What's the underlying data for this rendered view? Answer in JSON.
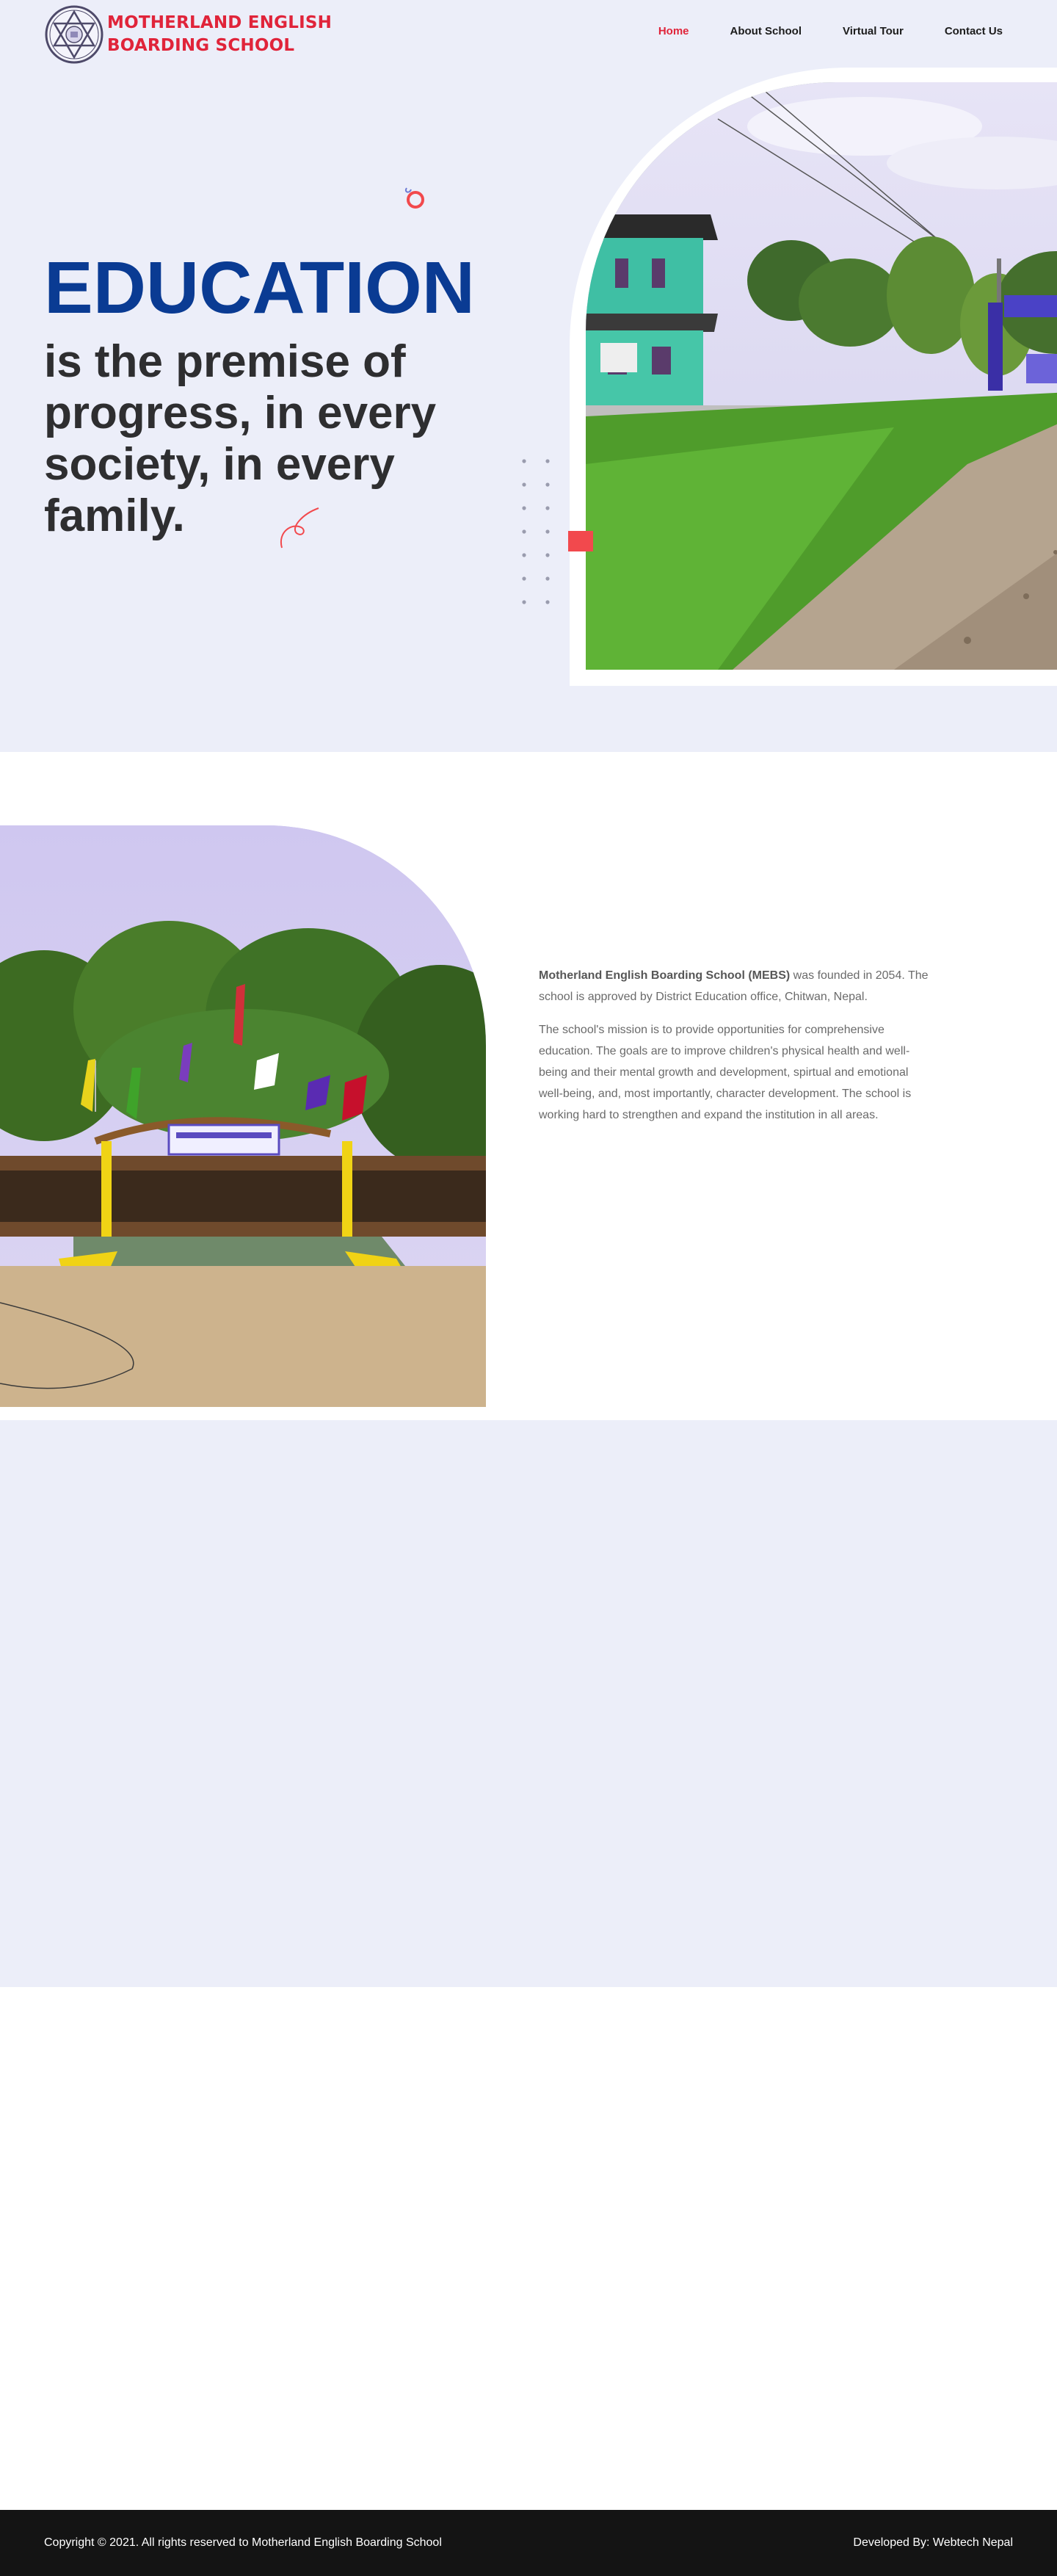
{
  "header": {
    "logo_line1": "MOTHERLAND ENGLISH",
    "logo_line2": "BOARDING SCHOOL",
    "nav": [
      {
        "label": "Home",
        "active": true
      },
      {
        "label": "About School",
        "active": false
      },
      {
        "label": "Virtual Tour",
        "active": false
      },
      {
        "label": "Contact Us",
        "active": false
      }
    ]
  },
  "hero": {
    "title": "EDUCATION",
    "subtitle": "is the premise of progress, in every society, in every family."
  },
  "about": {
    "school_name": "Motherland English Boarding School (MEBS)",
    "intro_rest": " was founded in 2054. The school is approved by District Education office, Chitwan, Nepal.",
    "mission": "The school's mission is to provide opportunities for comprehensive education. The goals are to improve children's physical health and well-being and their mental growth and development, spirtual and emotional well-being, and, most importantly, character development. The school is working hard to strengthen and expand the institution in all areas."
  },
  "footer": {
    "copyright": "Copyright © 2021. All rights reserved to Motherland English Boarding School",
    "developer": "Developed By: Webtech Nepal"
  },
  "colors": {
    "brand_red": "#e0243a",
    "brand_blue": "#0a3b93",
    "hero_bg": "#eceef9",
    "footer_bg": "#141414"
  },
  "icons": {
    "logo": "star-of-david-emblem-icon",
    "hero_deco_top": "swirl-decoration-icon",
    "hero_deco_bottom": "swirl-decoration-icon"
  }
}
